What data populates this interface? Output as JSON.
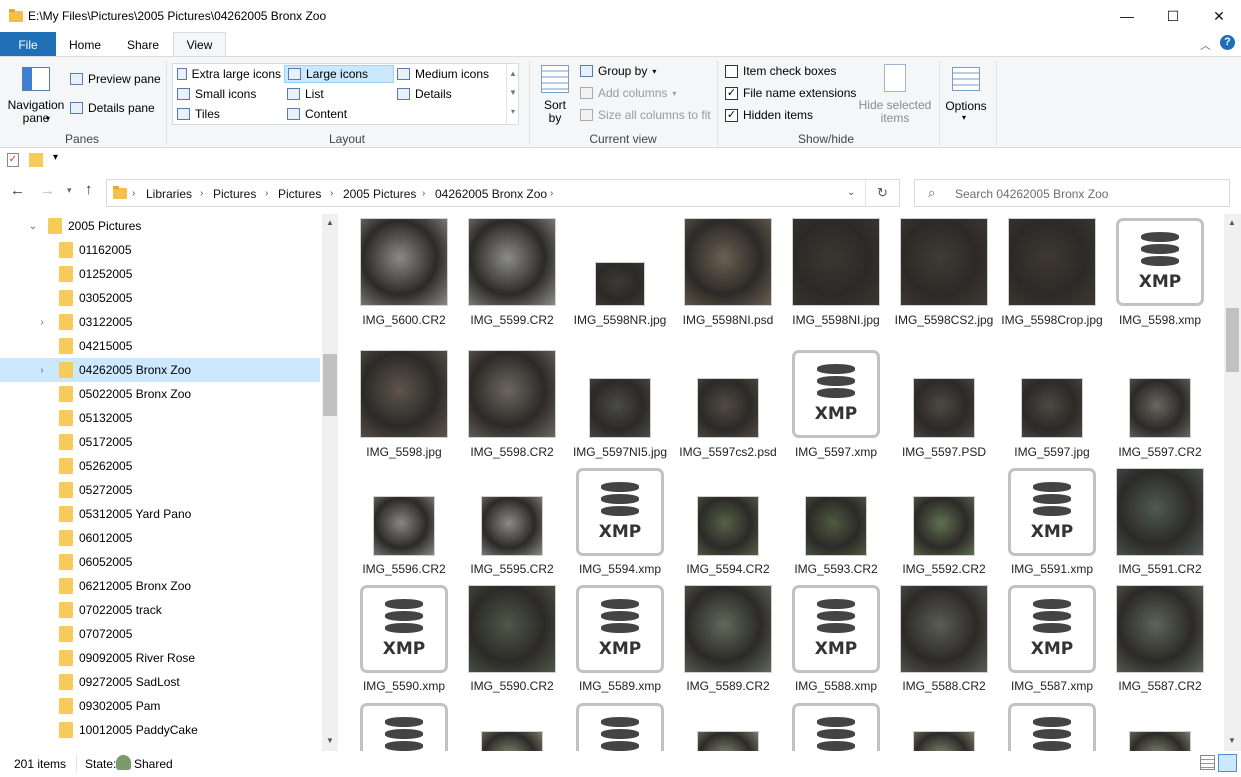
{
  "window": {
    "title": "E:\\My Files\\Pictures\\2005 Pictures\\04262005 Bronx Zoo",
    "minimize_icon": "—",
    "maximize_icon": "☐",
    "close_icon": "✕"
  },
  "tabs": [
    {
      "label": "File"
    },
    {
      "label": "Home"
    },
    {
      "label": "Share"
    },
    {
      "label": "View"
    }
  ],
  "ribbon": {
    "panes": {
      "label": "Panes",
      "navigation_pane": "Navigation\npane",
      "preview_pane": "Preview pane",
      "details_pane": "Details pane"
    },
    "layout": {
      "label": "Layout",
      "options": [
        {
          "label": "Extra large icons"
        },
        {
          "label": "Large icons",
          "selected": true
        },
        {
          "label": "Medium icons"
        },
        {
          "label": "Small icons"
        },
        {
          "label": "List"
        },
        {
          "label": "Details"
        },
        {
          "label": "Tiles"
        },
        {
          "label": "Content"
        }
      ]
    },
    "current_view": {
      "label": "Current view",
      "sort_by": "Sort\nby",
      "group_by": "Group by",
      "add_columns": "Add columns",
      "size_all_columns": "Size all columns to fit"
    },
    "show_hide": {
      "label": "Show/hide",
      "item_check_boxes": {
        "label": "Item check boxes",
        "checked": false
      },
      "file_name_extensions": {
        "label": "File name extensions",
        "checked": true
      },
      "hidden_items": {
        "label": "Hidden items",
        "checked": true
      },
      "hide_selected": "Hide selected\nitems"
    },
    "options": {
      "label": "Options"
    }
  },
  "address": {
    "crumbs": [
      "Libraries",
      "Pictures",
      "Pictures",
      "2005 Pictures",
      "04262005 Bronx Zoo"
    ],
    "search_placeholder": "Search 04262005 Bronx Zoo"
  },
  "nav": {
    "items": [
      {
        "label": "2005 Pictures",
        "level": 0,
        "expander": "open"
      },
      {
        "label": "01162005",
        "level": 1
      },
      {
        "label": "01252005",
        "level": 1
      },
      {
        "label": "03052005",
        "level": 1
      },
      {
        "label": "03122005",
        "level": 1,
        "expander": "closed"
      },
      {
        "label": "04215005",
        "level": 1
      },
      {
        "label": "04262005 Bronx Zoo",
        "level": 1,
        "expander": "closed",
        "selected": true
      },
      {
        "label": "05022005 Bronx Zoo",
        "level": 1
      },
      {
        "label": "05132005",
        "level": 1
      },
      {
        "label": "05172005",
        "level": 1
      },
      {
        "label": "05262005",
        "level": 1
      },
      {
        "label": "05272005",
        "level": 1
      },
      {
        "label": "05312005 Yard Pano",
        "level": 1
      },
      {
        "label": "06012005",
        "level": 1
      },
      {
        "label": "06052005",
        "level": 1
      },
      {
        "label": "06212005 Bronx Zoo",
        "level": 1
      },
      {
        "label": "07022005 track",
        "level": 1
      },
      {
        "label": "07072005",
        "level": 1
      },
      {
        "label": "09092005 River Rose",
        "level": 1
      },
      {
        "label": "09272005 SadLost",
        "level": 1
      },
      {
        "label": "09302005 Pam",
        "level": 1
      },
      {
        "label": "10012005 PaddyCake",
        "level": 1
      }
    ]
  },
  "files": [
    {
      "name": "IMG_5600.CR2",
      "kind": "photo",
      "tone": "#8a8a88"
    },
    {
      "name": "IMG_5599.CR2",
      "kind": "photo",
      "tone": "#8c8c8a"
    },
    {
      "name": "IMG_5598NR.jpg",
      "kind": "photo-small",
      "tone": "#3a3a36"
    },
    {
      "name": "IMG_5598NI.psd",
      "kind": "photo",
      "tone": "#6b5f52"
    },
    {
      "name": "IMG_5598NI.jpg",
      "kind": "photo",
      "tone": "#3b3630"
    },
    {
      "name": "IMG_5598CS2.jpg",
      "kind": "photo",
      "tone": "#403a34"
    },
    {
      "name": "IMG_5598Crop.jpg",
      "kind": "photo",
      "tone": "#3e3832"
    },
    {
      "name": "IMG_5598.xmp",
      "kind": "xmp"
    },
    {
      "name": "IMG_5598.jpg",
      "kind": "photo",
      "tone": "#5e554c"
    },
    {
      "name": "IMG_5598.CR2",
      "kind": "photo",
      "tone": "#6c665f"
    },
    {
      "name": "IMG_5597NI5.jpg",
      "kind": "photo-mid",
      "tone": "#4a4a4a"
    },
    {
      "name": "IMG_5597cs2.psd",
      "kind": "photo-mid",
      "tone": "#524a42"
    },
    {
      "name": "IMG_5597.xmp",
      "kind": "xmp"
    },
    {
      "name": "IMG_5597.PSD",
      "kind": "photo-mid",
      "tone": "#4d4842"
    },
    {
      "name": "IMG_5597.jpg",
      "kind": "photo-mid",
      "tone": "#4d4842"
    },
    {
      "name": "IMG_5597.CR2",
      "kind": "photo-mid",
      "tone": "#6a6660"
    },
    {
      "name": "IMG_5596.CR2",
      "kind": "photo-mid",
      "tone": "#878785"
    },
    {
      "name": "IMG_5595.CR2",
      "kind": "photo-mid",
      "tone": "#8a8a88"
    },
    {
      "name": "IMG_5594.xmp",
      "kind": "xmp"
    },
    {
      "name": "IMG_5594.CR2",
      "kind": "photo-mid",
      "tone": "#566148"
    },
    {
      "name": "IMG_5593.CR2",
      "kind": "photo-mid",
      "tone": "#4f5a41"
    },
    {
      "name": "IMG_5592.CR2",
      "kind": "photo-mid",
      "tone": "#5f7050"
    },
    {
      "name": "IMG_5591.xmp",
      "kind": "xmp"
    },
    {
      "name": "IMG_5591.CR2",
      "kind": "photo",
      "tone": "#4e5a55"
    },
    {
      "name": "IMG_5590.xmp",
      "kind": "xmp"
    },
    {
      "name": "IMG_5590.CR2",
      "kind": "photo",
      "tone": "#4e5848"
    },
    {
      "name": "IMG_5589.xmp",
      "kind": "xmp"
    },
    {
      "name": "IMG_5589.CR2",
      "kind": "photo",
      "tone": "#5f6a5a"
    },
    {
      "name": "IMG_5588.xmp",
      "kind": "xmp"
    },
    {
      "name": "IMG_5588.CR2",
      "kind": "photo",
      "tone": "#5a5c55"
    },
    {
      "name": "IMG_5587.xmp",
      "kind": "xmp"
    },
    {
      "name": "IMG_5587.CR2",
      "kind": "photo",
      "tone": "#5d6658"
    },
    {
      "name": "",
      "kind": "xmp"
    },
    {
      "name": "",
      "kind": "photo-mid",
      "tone": "#8a9078"
    },
    {
      "name": "",
      "kind": "xmp"
    },
    {
      "name": "",
      "kind": "photo-mid",
      "tone": "#8a9078"
    },
    {
      "name": "",
      "kind": "xmp"
    },
    {
      "name": "",
      "kind": "photo-mid",
      "tone": "#8a9078"
    },
    {
      "name": "",
      "kind": "xmp"
    },
    {
      "name": "",
      "kind": "photo-mid",
      "tone": "#8a9078"
    }
  ],
  "xmp_label": "XMP",
  "status": {
    "count": "201 items",
    "state_label": "State:",
    "state_value": "Shared"
  },
  "colors": {
    "accent": "#1e6fb5",
    "selection": "#cce8ff",
    "folder": "#f6cb58"
  }
}
